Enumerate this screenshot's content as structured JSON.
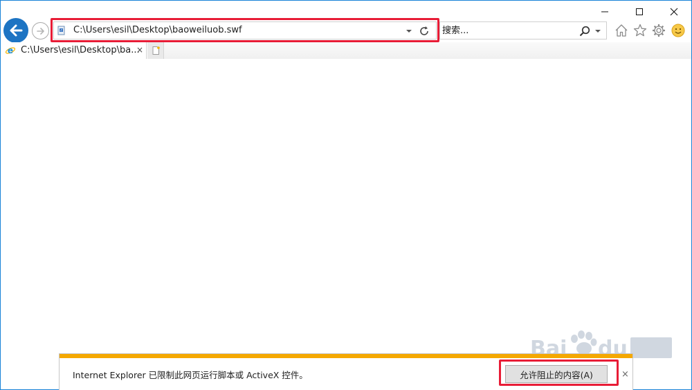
{
  "address_bar": {
    "url": "C:\\Users\\esil\\Desktop\\baoweiluob.swf"
  },
  "search": {
    "placeholder": "搜索..."
  },
  "tabs": [
    {
      "title": "C:\\Users\\esil\\Desktop\\ba...",
      "close": "×"
    }
  ],
  "notification": {
    "message": "Internet Explorer 已限制此网页运行脚本或 ActiveX 控件。",
    "allow_label": "允许阻止的内容(A)",
    "close": "×"
  },
  "colors": {
    "accent": "#1d74c3",
    "highlight": "#e81c36",
    "notify_stripe": "#f5a800"
  },
  "icons": [
    "back-arrow-icon",
    "forward-arrow-icon",
    "flash-file-icon",
    "dropdown-icon",
    "refresh-icon",
    "search-icon",
    "home-icon",
    "favorites-star-icon",
    "gear-icon",
    "smiley-feedback-icon",
    "ie-logo-icon",
    "new-tab-icon",
    "minimize-icon",
    "maximize-icon",
    "close-icon"
  ]
}
